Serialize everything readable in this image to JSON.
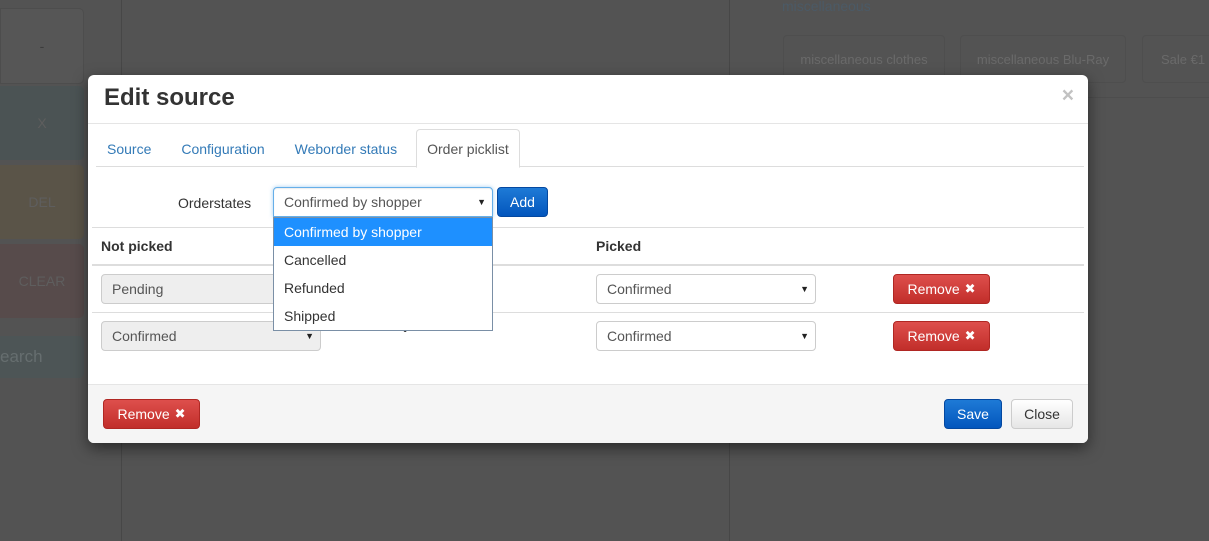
{
  "background": {
    "keys": [
      "-",
      "X",
      "DEL",
      "CLEAR",
      "earch"
    ],
    "category_title": "miscellaneous",
    "categories": [
      "miscellaneous clothes",
      "miscellaneous Blu-Ray",
      "Sale €1"
    ]
  },
  "modal": {
    "title": "Edit source",
    "close_icon": "×",
    "tabs": [
      {
        "label": "Source",
        "active": false
      },
      {
        "label": "Configuration",
        "active": false
      },
      {
        "label": "Weborder status",
        "active": false
      },
      {
        "label": "Order picklist",
        "active": true
      }
    ],
    "orderstates": {
      "label": "Orderstates",
      "selected": "Confirmed by shopper",
      "add_label": "Add",
      "options": [
        "Confirmed by shopper",
        "Cancelled",
        "Refunded",
        "Shipped"
      ]
    },
    "table": {
      "headers": {
        "not_picked": "Not picked",
        "picked": "Picked"
      },
      "arrow": "➔",
      "rows": [
        {
          "not_picked": "Pending",
          "picked": "Confirmed",
          "remove_label": "Remove"
        },
        {
          "not_picked": "Confirmed",
          "picked": "Confirmed",
          "remove_label": "Remove"
        }
      ]
    },
    "footer": {
      "remove_label": "Remove",
      "save_label": "Save",
      "close_label": "Close"
    },
    "x_icon": "✖",
    "select_arrow": "▼"
  },
  "colors": {
    "primary": "#0a68cc",
    "danger": "#d43f3a",
    "link": "#337ab7",
    "dropdown_highlight": "#1e90ff"
  }
}
